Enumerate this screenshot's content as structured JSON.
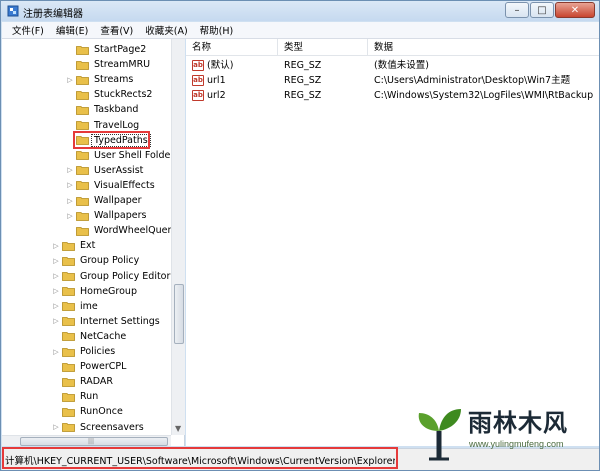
{
  "window": {
    "title": "注册表编辑器"
  },
  "caption": {
    "minimize": "–",
    "maximize": "□",
    "close": "✕"
  },
  "menu": [
    "文件(F)",
    "编辑(E)",
    "查看(V)",
    "收藏夹(A)",
    "帮助(H)"
  ],
  "tree": [
    {
      "label": "StartPage2",
      "expandable": false,
      "level": 2
    },
    {
      "label": "StreamMRU",
      "expandable": false,
      "level": 2
    },
    {
      "label": "Streams",
      "expandable": true,
      "level": 2
    },
    {
      "label": "StuckRects2",
      "expandable": false,
      "level": 2
    },
    {
      "label": "Taskband",
      "expandable": false,
      "level": 2
    },
    {
      "label": "TravelLog",
      "expandable": false,
      "level": 2
    },
    {
      "label": "TypedPaths",
      "expandable": false,
      "level": 2,
      "selected": true
    },
    {
      "label": "User Shell Folders",
      "expandable": false,
      "level": 2
    },
    {
      "label": "UserAssist",
      "expandable": true,
      "level": 2
    },
    {
      "label": "VisualEffects",
      "expandable": true,
      "level": 2
    },
    {
      "label": "Wallpaper",
      "expandable": true,
      "level": 2
    },
    {
      "label": "Wallpapers",
      "expandable": true,
      "level": 2
    },
    {
      "label": "WordWheelQuery",
      "expandable": false,
      "level": 2
    },
    {
      "label": "Ext",
      "expandable": true,
      "level": 1
    },
    {
      "label": "Group Policy",
      "expandable": true,
      "level": 1
    },
    {
      "label": "Group Policy Editor",
      "expandable": true,
      "level": 1
    },
    {
      "label": "HomeGroup",
      "expandable": true,
      "level": 1
    },
    {
      "label": "ime",
      "expandable": true,
      "level": 1
    },
    {
      "label": "Internet Settings",
      "expandable": true,
      "level": 1
    },
    {
      "label": "NetCache",
      "expandable": false,
      "level": 1
    },
    {
      "label": "Policies",
      "expandable": true,
      "level": 1
    },
    {
      "label": "PowerCPL",
      "expandable": false,
      "level": 1
    },
    {
      "label": "RADAR",
      "expandable": false,
      "level": 1
    },
    {
      "label": "Run",
      "expandable": false,
      "level": 1
    },
    {
      "label": "RunOnce",
      "expandable": false,
      "level": 1
    },
    {
      "label": "Screensavers",
      "expandable": true,
      "level": 1
    }
  ],
  "list": {
    "columns": [
      "名称",
      "类型",
      "数据"
    ],
    "rows": [
      {
        "name": "(默认)",
        "type": "REG_SZ",
        "data": "(数值未设置)"
      },
      {
        "name": "url1",
        "type": "REG_SZ",
        "data": "C:\\Users\\Administrator\\Desktop\\Win7主题"
      },
      {
        "name": "url2",
        "type": "REG_SZ",
        "data": "C:\\Windows\\System32\\LogFiles\\WMI\\RtBackup"
      }
    ]
  },
  "status": {
    "path": "计算机\\HKEY_CURRENT_USER\\Software\\Microsoft\\Windows\\CurrentVersion\\Explorer\\TypedPaths"
  },
  "watermark": {
    "name": "雨林木风",
    "url": "www.yulingmufeng.com"
  },
  "colors": {
    "folder": "#e9c04a",
    "highlight": "#e53a3a",
    "string_icon": "#c0392b"
  },
  "icons": {
    "folder": "folder-icon",
    "string_value": "reg-sz-icon",
    "expand": "expand-arrow-icon"
  }
}
